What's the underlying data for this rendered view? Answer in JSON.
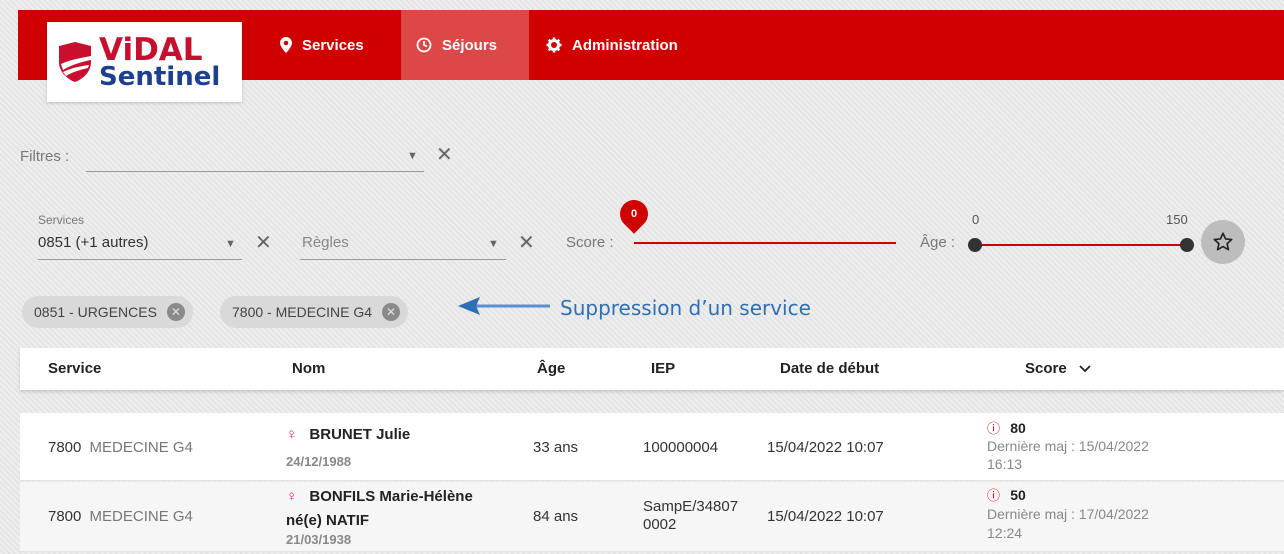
{
  "brand": {
    "line1": "ViDAL",
    "line2": "Sentinel"
  },
  "nav": {
    "services": "Services",
    "sejours": "Séjours",
    "administration": "Administration"
  },
  "filters": {
    "label": "Filtres :",
    "value": ""
  },
  "services_select": {
    "label": "Services",
    "value": "0851 (+1 autres)"
  },
  "regles_select": {
    "placeholder": "Règles"
  },
  "score_slider": {
    "label": "Score :",
    "value": "0"
  },
  "age_slider": {
    "label": "Âge :",
    "min": "0",
    "max": "150"
  },
  "chips": [
    {
      "label": "0851 - URGENCES"
    },
    {
      "label": "7800 - MEDECINE G4"
    }
  ],
  "annotation": "Suppression d’un service",
  "table": {
    "headers": {
      "service": "Service",
      "nom": "Nom",
      "age": "Âge",
      "iep": "IEP",
      "date": "Date de début",
      "score": "Score"
    },
    "rows": [
      {
        "service_code": "7800",
        "service_name": "MEDECINE G4",
        "name": "BRUNET Julie",
        "name_line2": "",
        "dob": "24/12/1988",
        "age": "33 ans",
        "iep_line1": "100000004",
        "iep_line2": "",
        "date": "15/04/2022 10:07",
        "score": "80",
        "maj_line1": "Dernière maj : 15/04/2022",
        "maj_line2": "16:13"
      },
      {
        "service_code": "7800",
        "service_name": "MEDECINE G4",
        "name": "BONFILS Marie-Hélène",
        "name_line2": "né(e) NATIF",
        "dob": "21/03/1938",
        "age": "84 ans",
        "iep_line1": "SampE/34807",
        "iep_line2": "0002",
        "date": "15/04/2022 10:07",
        "score": "50",
        "maj_line1": "Dernière maj : 17/04/2022",
        "maj_line2": "12:24"
      }
    ]
  },
  "colors": {
    "primary": "#d00000",
    "annotation": "#2e6fb5",
    "brand_blue": "#1c3f8f"
  },
  "icons": [
    "map-marker-icon",
    "clock-icon",
    "gear-icon",
    "caret-down-icon",
    "close-icon",
    "star-icon",
    "female-icon",
    "alert-circle-icon",
    "chevron-down-icon",
    "arrow-left-icon"
  ]
}
